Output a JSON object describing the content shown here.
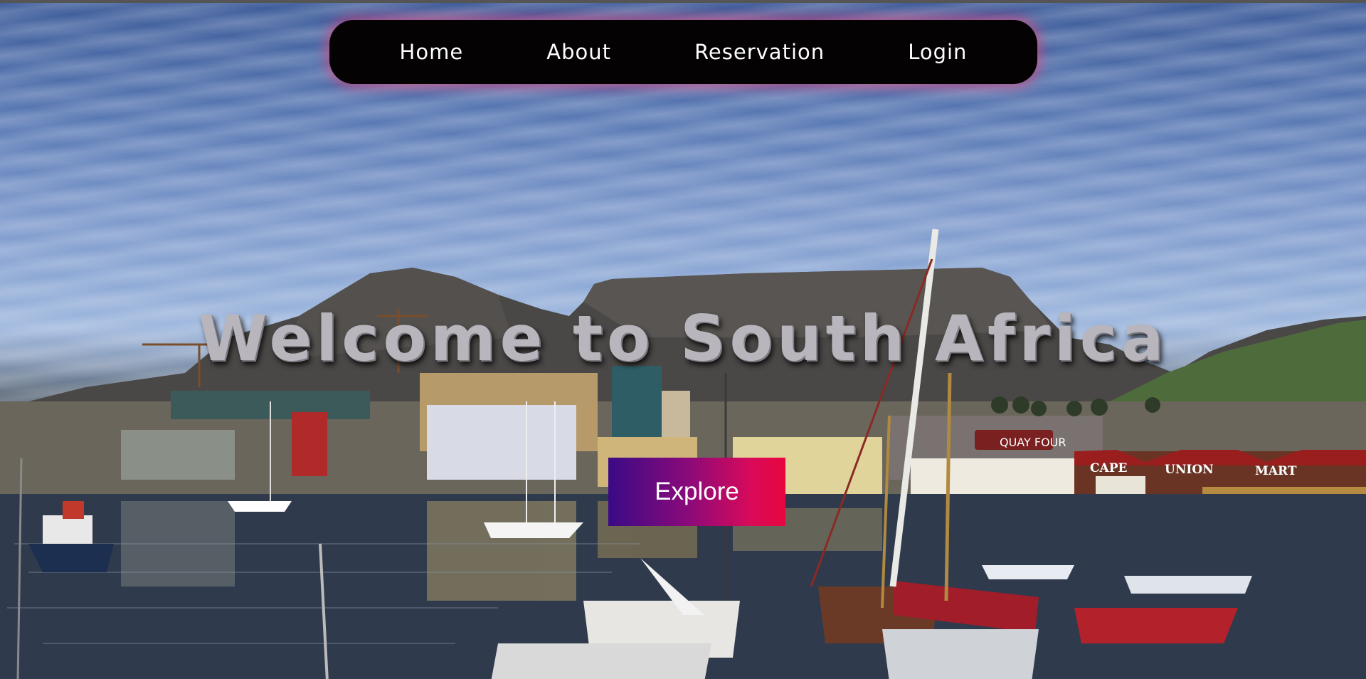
{
  "nav": {
    "items": [
      {
        "label": "Home"
      },
      {
        "label": "About"
      },
      {
        "label": "Reservation"
      },
      {
        "label": "Login"
      }
    ]
  },
  "hero": {
    "title": "Welcome to South Africa",
    "cta_label": "Explore",
    "signs": {
      "quay": "QUAY FOUR",
      "cape": "CAPE",
      "union": "UNION",
      "mart": "MART"
    }
  },
  "colors": {
    "nav_bg": "#050203",
    "nav_glow": "#e63c78",
    "cta_gradient_start": "#3a0a86",
    "cta_gradient_end": "#e8063e",
    "title": "#b8b6bc"
  }
}
